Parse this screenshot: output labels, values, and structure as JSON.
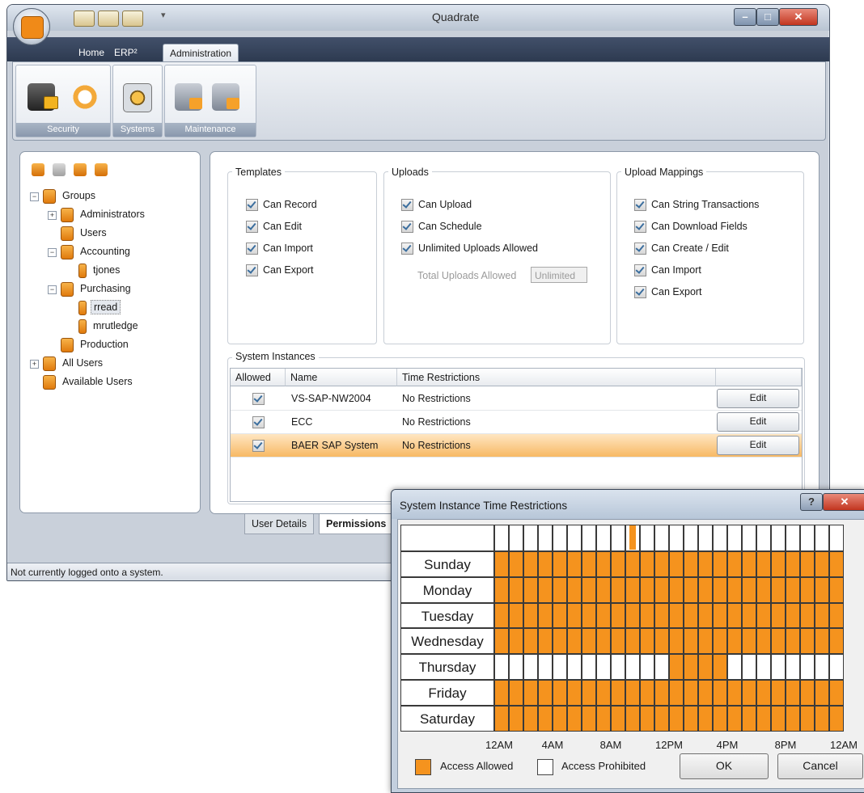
{
  "window": {
    "title": "Quadrate",
    "status": "Not currently logged onto a system."
  },
  "ribbon": {
    "tabs": [
      "Home",
      "ERP²",
      "Administration"
    ],
    "active_tab": "Administration",
    "groups": [
      "Security",
      "Systems",
      "Maintenance"
    ]
  },
  "tree": {
    "items": [
      {
        "label": "Groups",
        "level": 0,
        "expander": "minus"
      },
      {
        "label": "Administrators",
        "level": 1,
        "expander": "plus"
      },
      {
        "label": "Users",
        "level": 1,
        "expander": ""
      },
      {
        "label": "Accounting",
        "level": 1,
        "expander": "minus"
      },
      {
        "label": "tjones",
        "level": 2,
        "expander": ""
      },
      {
        "label": "Purchasing",
        "level": 1,
        "expander": "minus"
      },
      {
        "label": "rread",
        "level": 2,
        "expander": "",
        "selected": true
      },
      {
        "label": "mrutledge",
        "level": 2,
        "expander": ""
      },
      {
        "label": "Production",
        "level": 1,
        "expander": ""
      },
      {
        "label": "All Users",
        "level": 0,
        "expander": "plus"
      },
      {
        "label": "Available Users",
        "level": 0,
        "expander": ""
      }
    ]
  },
  "permissions": {
    "templates": {
      "title": "Templates",
      "items": [
        "Can Record",
        "Can Edit",
        "Can Import",
        "Can Export"
      ]
    },
    "uploads": {
      "title": "Uploads",
      "items": [
        "Can Upload",
        "Can Schedule",
        "Unlimited Uploads Allowed"
      ],
      "total_label": "Total Uploads Allowed",
      "total_value": "Unlimited"
    },
    "upload_mappings": {
      "title": "Upload Mappings",
      "items": [
        "Can String Transactions",
        "Can Download Fields",
        "Can Create / Edit",
        "Can Import",
        "Can Export"
      ]
    }
  },
  "system_instances": {
    "title": "System Instances",
    "columns": [
      "Allowed",
      "Name",
      "Time Restrictions"
    ],
    "rows": [
      {
        "name": "VS-SAP-NW2004",
        "restriction": "No Restrictions",
        "button": "Edit"
      },
      {
        "name": "ECC",
        "restriction": "No Restrictions",
        "button": "Edit"
      },
      {
        "name": "BAER SAP System",
        "restriction": "No Restrictions",
        "button": "Edit",
        "selected": true
      }
    ]
  },
  "bottom_tabs": [
    "User Details",
    "Permissions"
  ],
  "dialog": {
    "title": "System Instance Time Restrictions",
    "days": [
      "Sunday",
      "Monday",
      "Tuesday",
      "Wednesday",
      "Thursday",
      "Friday",
      "Saturday"
    ],
    "hour_labels": [
      "12AM",
      "4AM",
      "8AM",
      "12PM",
      "4PM",
      "8PM",
      "12AM"
    ],
    "allowed_color": "#f5931e",
    "prohibited_color": "#ffffff",
    "thursday_allowed_hours": [
      12,
      13,
      14,
      15
    ],
    "selected_hour": 9,
    "legend_allowed": "Access Allowed",
    "legend_prohibited": "Access Prohibited",
    "ok": "OK",
    "cancel": "Cancel",
    "help": "?"
  }
}
